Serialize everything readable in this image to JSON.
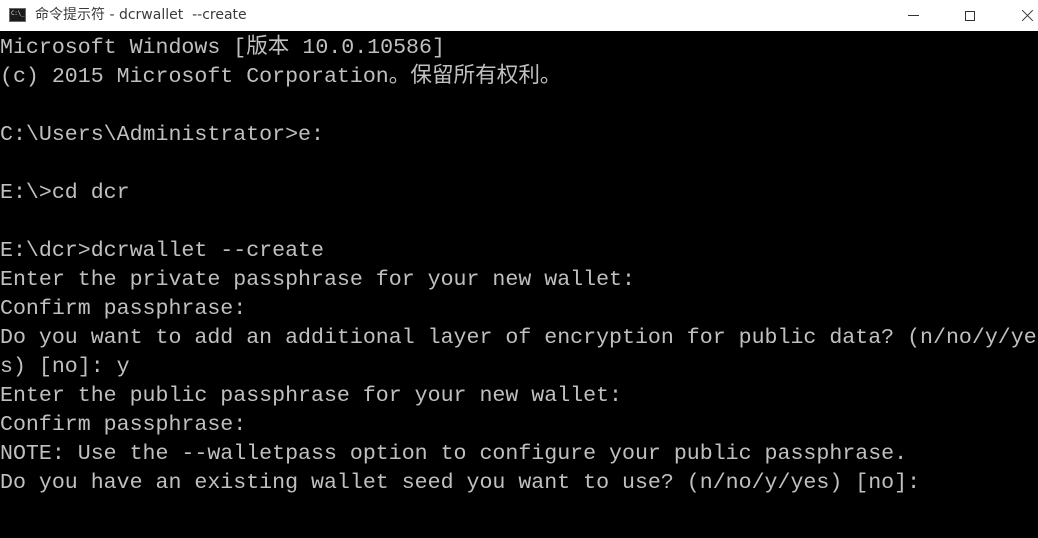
{
  "window": {
    "title": "命令提示符 - dcrwallet  --create",
    "app_icon": "cmd-icon",
    "icon_text": "C:\\_",
    "controls": {
      "minimize": "minimize-icon",
      "maximize": "maximize-icon",
      "close": "close-icon"
    }
  },
  "console": {
    "text_color": "#c0c0c0",
    "background": "#000000",
    "lines": [
      "Microsoft Windows [版本 10.0.10586]",
      "(c) 2015 Microsoft Corporation。保留所有权利。",
      "",
      "C:\\Users\\Administrator>e:",
      "",
      "E:\\>cd dcr",
      "",
      "E:\\dcr>dcrwallet --create",
      "Enter the private passphrase for your new wallet:",
      "Confirm passphrase:",
      "Do you want to add an additional layer of encryption for public data? (n/no/y/ye",
      "s) [no]: y",
      "Enter the public passphrase for your new wallet:",
      "Confirm passphrase:",
      "NOTE: Use the --walletpass option to configure your public passphrase.",
      "Do you have an existing wallet seed you want to use? (n/no/y/yes) [no]:"
    ]
  }
}
